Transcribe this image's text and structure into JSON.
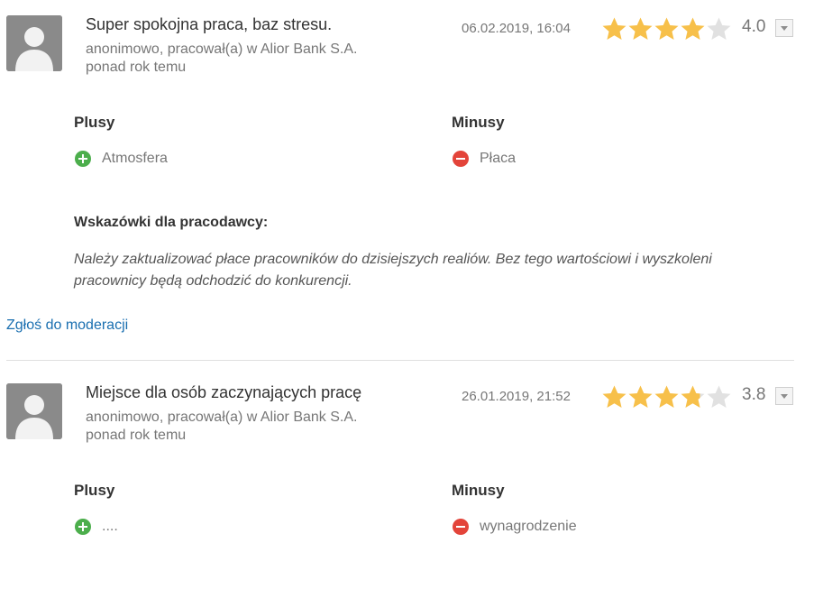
{
  "reviews": [
    {
      "title": "Super spokojna praca, baz stresu.",
      "author_line": "anonimowo, pracował(a) w Alior Bank S.A.",
      "time_ago": "ponad rok temu",
      "date": "06.02.2019, 16:04",
      "rating": 4,
      "score": "4.0",
      "plus_label": "Plusy",
      "minus_label": "Minusy",
      "plus_item": "Atmosfera",
      "minus_item": "Płaca",
      "tips_label": "Wskazówki dla pracodawcy:",
      "tips_text": "Należy zaktualizować płace pracowników do dzisiejszych realiów. Bez tego wartościowi i wyszkoleni pracownicy będą odchodzić do konkurencji.",
      "report_link": "Zgłoś do moderacji"
    },
    {
      "title": "Miejsce dla osób zaczynających pracę",
      "author_line": "anonimowo, pracował(a) w Alior Bank S.A.",
      "time_ago": "ponad rok temu",
      "date": "26.01.2019, 21:52",
      "rating": 3.8,
      "score": "3.8",
      "plus_label": "Plusy",
      "minus_label": "Minusy",
      "plus_item": "....",
      "minus_item": "wynagrodzenie"
    }
  ],
  "colors": {
    "star_filled": "#f7c04a",
    "star_empty": "#e1e1e1",
    "plus": "#4cae4c",
    "minus": "#e3443a",
    "link": "#1a6fb0"
  },
  "icons": {
    "avatar": "user-silhouette-icon",
    "star": "star-icon",
    "dropdown": "caret-down-icon",
    "plus": "plus-circle-icon",
    "minus": "minus-circle-icon"
  }
}
